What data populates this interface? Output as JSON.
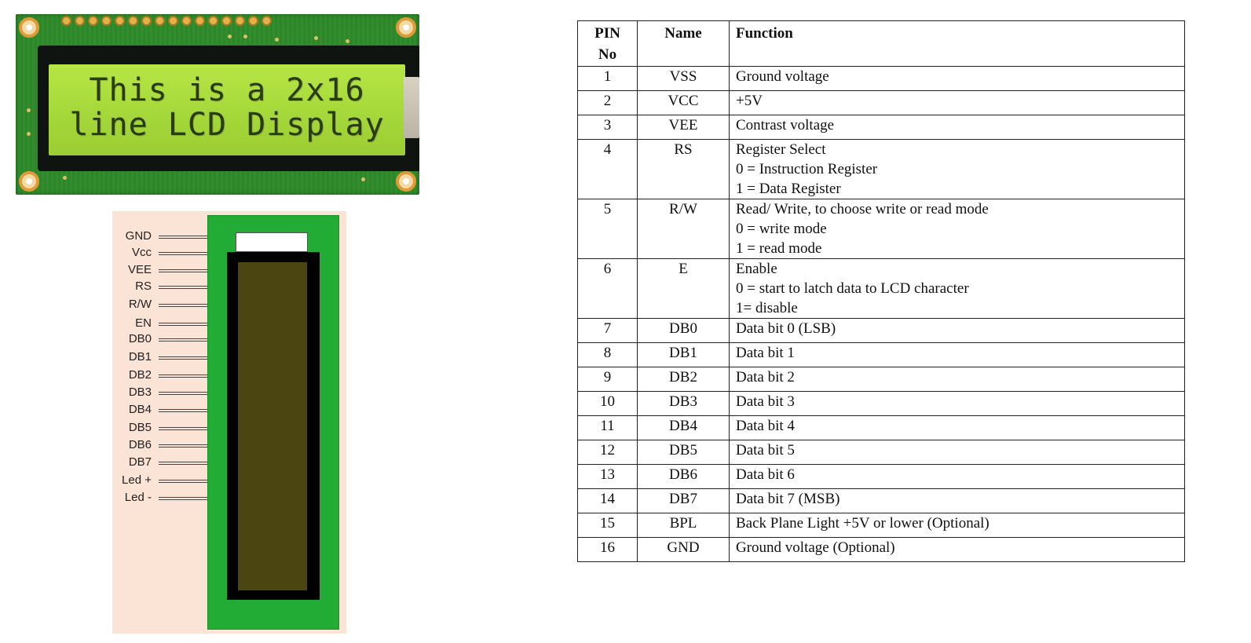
{
  "lcd_photo": {
    "line1": "This is a 2x16",
    "line2": "line LCD Display"
  },
  "pin_diagram": {
    "labels": [
      "GND",
      "Vcc",
      "VEE",
      "RS",
      "R/W",
      "EN",
      "DB0",
      "DB1",
      "DB2",
      "DB3",
      "DB4",
      "DB5",
      "DB6",
      "DB7",
      "Led +",
      "Led -"
    ]
  },
  "table": {
    "headers": {
      "pin": [
        "PIN",
        "No"
      ],
      "name": "Name",
      "function": "Function"
    },
    "rows": [
      {
        "pin": "1",
        "name": "VSS",
        "function": [
          "Ground voltage"
        ]
      },
      {
        "pin": "2",
        "name": "VCC",
        "function": [
          "+5V"
        ]
      },
      {
        "pin": "3",
        "name": "VEE",
        "function": [
          "Contrast voltage"
        ]
      },
      {
        "pin": "4",
        "name": "RS",
        "function": [
          "Register Select",
          "0 = Instruction Register",
          "1 = Data Register"
        ]
      },
      {
        "pin": "5",
        "name": "R/W",
        "function": [
          "Read/ Write, to choose write or read mode",
          "0 = write mode",
          "1 = read mode"
        ]
      },
      {
        "pin": "6",
        "name": "E",
        "function": [
          "Enable",
          "0 = start to latch data to LCD character",
          "1= disable"
        ]
      },
      {
        "pin": "7",
        "name": "DB0",
        "function": [
          "Data bit 0 (LSB)"
        ]
      },
      {
        "pin": "8",
        "name": "DB1",
        "function": [
          "Data bit 1"
        ]
      },
      {
        "pin": "9",
        "name": "DB2",
        "function": [
          "Data bit 2"
        ]
      },
      {
        "pin": "10",
        "name": "DB3",
        "function": [
          "Data bit 3"
        ]
      },
      {
        "pin": "11",
        "name": "DB4",
        "function": [
          "Data bit 4"
        ]
      },
      {
        "pin": "12",
        "name": "DB5",
        "function": [
          "Data bit 5"
        ]
      },
      {
        "pin": "13",
        "name": "DB6",
        "function": [
          "Data bit 6"
        ]
      },
      {
        "pin": "14",
        "name": "DB7",
        "function": [
          "Data bit 7 (MSB)"
        ]
      },
      {
        "pin": "15",
        "name": "BPL",
        "function": [
          "Back Plane Light +5V or lower (Optional)"
        ]
      },
      {
        "pin": "16",
        "name": "GND",
        "function": [
          "Ground voltage (Optional)"
        ]
      }
    ]
  }
}
